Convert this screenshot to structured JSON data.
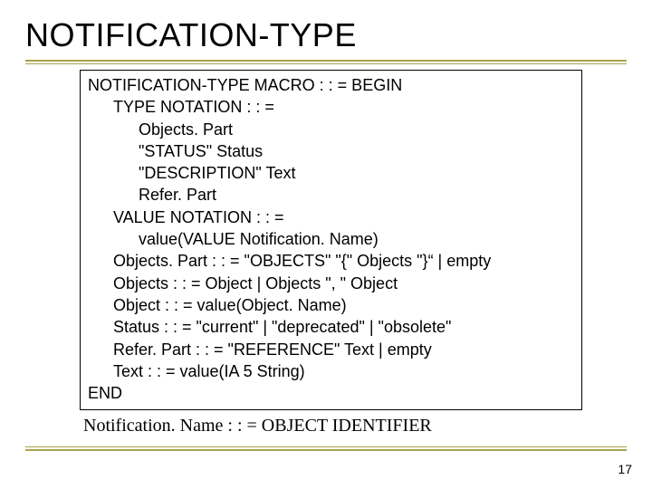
{
  "title": "NOTIFICATION-TYPE",
  "code": {
    "l1": "NOTIFICATION-TYPE MACRO : : = BEGIN",
    "l2": "TYPE NOTATION : : =",
    "l3": "Objects. Part",
    "l4": "\"STATUS\" Status",
    "l5": "\"DESCRIPTION\" Text",
    "l6": "Refer. Part",
    "l7": "VALUE NOTATION : : =",
    "l8": "value(VALUE Notification. Name)",
    "l9": "Objects. Part : : = \"OBJECTS\" \"{\" Objects \"}“ | empty",
    "l10": "Objects : : = Object | Objects \", \" Object",
    "l11": "Object : : = value(Object. Name)",
    "l12": "Status : : = \"current\" | \"deprecated\" | \"obsolete\"",
    "l13": "Refer. Part : : = \"REFERENCE\" Text | empty",
    "l14": "Text : : = value(IA 5 String)",
    "l15": "END"
  },
  "footer": "Notification. Name : : = OBJECT IDENTIFIER",
  "page": "17"
}
